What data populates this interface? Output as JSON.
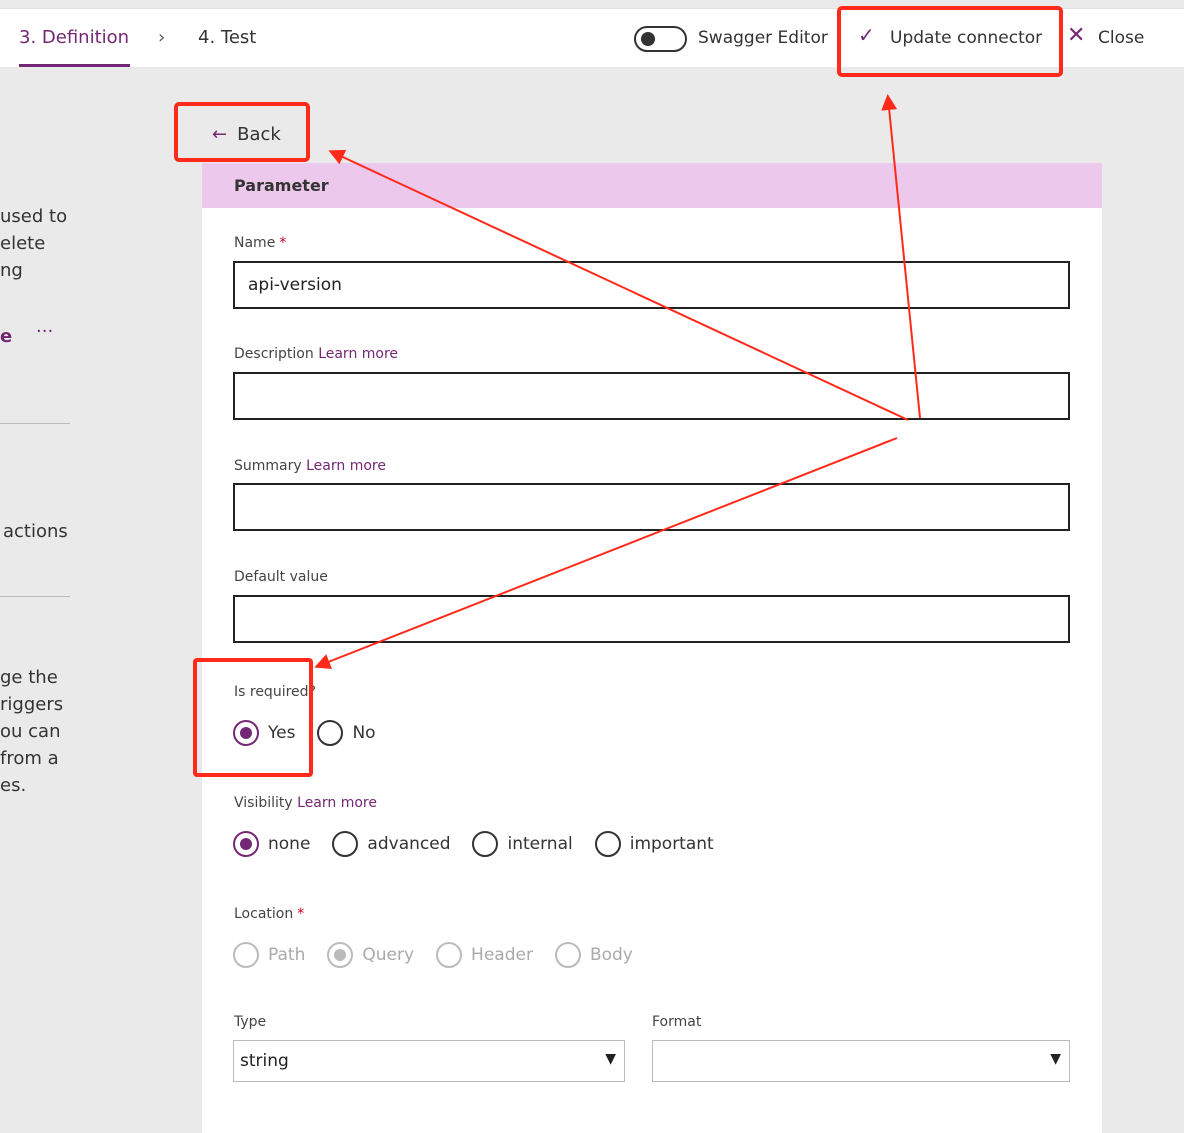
{
  "header": {
    "tabs": [
      {
        "label": "3. Definition",
        "active": true
      },
      {
        "label": "4. Test"
      }
    ],
    "swagger_label": "Swagger Editor",
    "swagger_on": false,
    "update_label": "Update connector",
    "close_label": "Close"
  },
  "sidebar_fragments": [
    "used to",
    "elete",
    "ng",
    "e",
    "···",
    "actions",
    "ge the",
    "riggers",
    "ou can",
    "from a",
    "es."
  ],
  "back_label": "Back",
  "panel": {
    "title": "Parameter",
    "name": {
      "label": "Name",
      "required": "*",
      "value": "api-version"
    },
    "description": {
      "label": "Description",
      "link": "Learn more",
      "value": ""
    },
    "summary": {
      "label": "Summary",
      "link": "Learn more",
      "value": ""
    },
    "default": {
      "label": "Default value",
      "value": ""
    },
    "is_required": {
      "label": "Is required?",
      "options": [
        "Yes",
        "No"
      ],
      "selected": "Yes"
    },
    "visibility": {
      "label": "Visibility",
      "link": "Learn more",
      "options": [
        "none",
        "advanced",
        "internal",
        "important"
      ],
      "selected": "none"
    },
    "location": {
      "label": "Location",
      "required": "*",
      "options": [
        "Path",
        "Query",
        "Header",
        "Body"
      ],
      "selected": "Query"
    },
    "type": {
      "label": "Type",
      "value": "string"
    },
    "format": {
      "label": "Format",
      "value": ""
    }
  },
  "colors": {
    "accent": "#742774",
    "header_band": "#ecc8ec",
    "annotation": "#ff2a1a"
  }
}
